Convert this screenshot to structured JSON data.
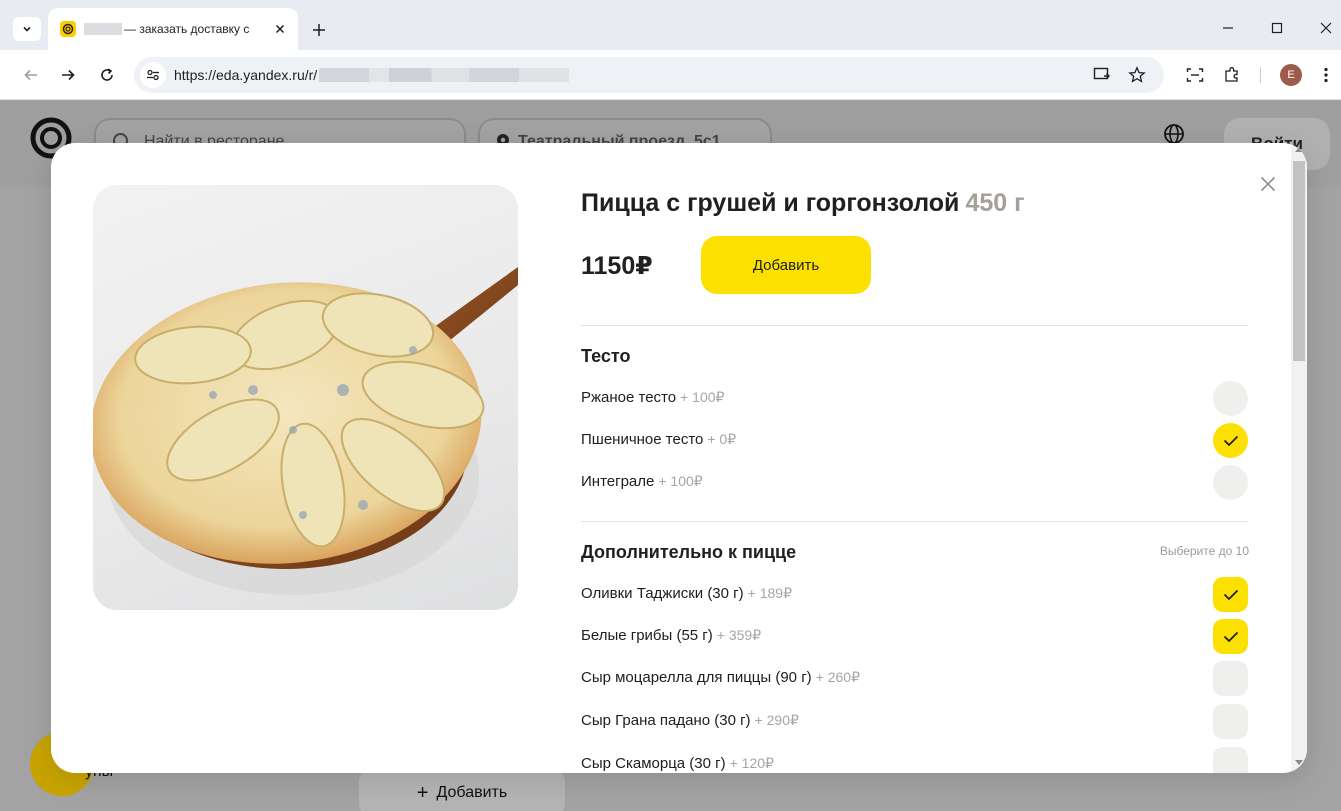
{
  "browser": {
    "tab_title": "— заказать доставку с",
    "url": "https://eda.yandex.ru/r/",
    "profile_initial": "E"
  },
  "page": {
    "search_placeholder": "Найти в ресторане",
    "address": "Театральный проезд, 5с1",
    "login_label": "Войти",
    "bottom_add_plus": "+",
    "bottom_add_label": "Добавить",
    "fab_label": "упы"
  },
  "product": {
    "title": "Пицца с грушей и горгонзолой",
    "weight": "450 г",
    "price": "1150₽",
    "add_label": "Добавить"
  },
  "groups": [
    {
      "title": "Тесто",
      "hint": "",
      "type": "radio",
      "options": [
        {
          "label": "Ржаное тесто",
          "price": "+ 100₽",
          "selected": false
        },
        {
          "label": "Пшеничное тесто",
          "price": "+ 0₽",
          "selected": true
        },
        {
          "label": "Интеграле",
          "price": "+ 100₽",
          "selected": false
        }
      ]
    },
    {
      "title": "Дополнительно к пицце",
      "hint": "Выберите до 10",
      "type": "checkbox",
      "options": [
        {
          "label": "Оливки Таджиски (30 г)",
          "price": "+ 189₽",
          "selected": true
        },
        {
          "label": "Белые грибы (55 г)",
          "price": "+ 359₽",
          "selected": true
        },
        {
          "label": "Сыр моцарелла для пиццы (90 г)",
          "price": "+ 260₽",
          "selected": false
        },
        {
          "label": "Сыр Грана падано (30 г)",
          "price": "+ 290₽",
          "selected": false
        },
        {
          "label": "Сыр Скаморца (30 г)",
          "price": "+ 120₽",
          "selected": false
        }
      ]
    }
  ],
  "colors": {
    "accent_yellow": "#fce000",
    "muted_price": "#a8a5a0"
  }
}
